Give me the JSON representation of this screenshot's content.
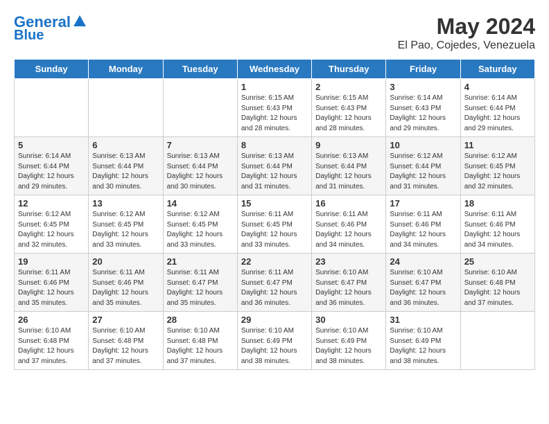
{
  "header": {
    "logo_line1": "General",
    "logo_line2": "Blue",
    "month": "May 2024",
    "location": "El Pao, Cojedes, Venezuela"
  },
  "weekdays": [
    "Sunday",
    "Monday",
    "Tuesday",
    "Wednesday",
    "Thursday",
    "Friday",
    "Saturday"
  ],
  "weeks": [
    [
      {
        "day": "",
        "info": ""
      },
      {
        "day": "",
        "info": ""
      },
      {
        "day": "",
        "info": ""
      },
      {
        "day": "1",
        "info": "Sunrise: 6:15 AM\nSunset: 6:43 PM\nDaylight: 12 hours\nand 28 minutes."
      },
      {
        "day": "2",
        "info": "Sunrise: 6:15 AM\nSunset: 6:43 PM\nDaylight: 12 hours\nand 28 minutes."
      },
      {
        "day": "3",
        "info": "Sunrise: 6:14 AM\nSunset: 6:43 PM\nDaylight: 12 hours\nand 29 minutes."
      },
      {
        "day": "4",
        "info": "Sunrise: 6:14 AM\nSunset: 6:44 PM\nDaylight: 12 hours\nand 29 minutes."
      }
    ],
    [
      {
        "day": "5",
        "info": "Sunrise: 6:14 AM\nSunset: 6:44 PM\nDaylight: 12 hours\nand 29 minutes."
      },
      {
        "day": "6",
        "info": "Sunrise: 6:13 AM\nSunset: 6:44 PM\nDaylight: 12 hours\nand 30 minutes."
      },
      {
        "day": "7",
        "info": "Sunrise: 6:13 AM\nSunset: 6:44 PM\nDaylight: 12 hours\nand 30 minutes."
      },
      {
        "day": "8",
        "info": "Sunrise: 6:13 AM\nSunset: 6:44 PM\nDaylight: 12 hours\nand 31 minutes."
      },
      {
        "day": "9",
        "info": "Sunrise: 6:13 AM\nSunset: 6:44 PM\nDaylight: 12 hours\nand 31 minutes."
      },
      {
        "day": "10",
        "info": "Sunrise: 6:12 AM\nSunset: 6:44 PM\nDaylight: 12 hours\nand 31 minutes."
      },
      {
        "day": "11",
        "info": "Sunrise: 6:12 AM\nSunset: 6:45 PM\nDaylight: 12 hours\nand 32 minutes."
      }
    ],
    [
      {
        "day": "12",
        "info": "Sunrise: 6:12 AM\nSunset: 6:45 PM\nDaylight: 12 hours\nand 32 minutes."
      },
      {
        "day": "13",
        "info": "Sunrise: 6:12 AM\nSunset: 6:45 PM\nDaylight: 12 hours\nand 33 minutes."
      },
      {
        "day": "14",
        "info": "Sunrise: 6:12 AM\nSunset: 6:45 PM\nDaylight: 12 hours\nand 33 minutes."
      },
      {
        "day": "15",
        "info": "Sunrise: 6:11 AM\nSunset: 6:45 PM\nDaylight: 12 hours\nand 33 minutes."
      },
      {
        "day": "16",
        "info": "Sunrise: 6:11 AM\nSunset: 6:46 PM\nDaylight: 12 hours\nand 34 minutes."
      },
      {
        "day": "17",
        "info": "Sunrise: 6:11 AM\nSunset: 6:46 PM\nDaylight: 12 hours\nand 34 minutes."
      },
      {
        "day": "18",
        "info": "Sunrise: 6:11 AM\nSunset: 6:46 PM\nDaylight: 12 hours\nand 34 minutes."
      }
    ],
    [
      {
        "day": "19",
        "info": "Sunrise: 6:11 AM\nSunset: 6:46 PM\nDaylight: 12 hours\nand 35 minutes."
      },
      {
        "day": "20",
        "info": "Sunrise: 6:11 AM\nSunset: 6:46 PM\nDaylight: 12 hours\nand 35 minutes."
      },
      {
        "day": "21",
        "info": "Sunrise: 6:11 AM\nSunset: 6:47 PM\nDaylight: 12 hours\nand 35 minutes."
      },
      {
        "day": "22",
        "info": "Sunrise: 6:11 AM\nSunset: 6:47 PM\nDaylight: 12 hours\nand 36 minutes."
      },
      {
        "day": "23",
        "info": "Sunrise: 6:10 AM\nSunset: 6:47 PM\nDaylight: 12 hours\nand 36 minutes."
      },
      {
        "day": "24",
        "info": "Sunrise: 6:10 AM\nSunset: 6:47 PM\nDaylight: 12 hours\nand 36 minutes."
      },
      {
        "day": "25",
        "info": "Sunrise: 6:10 AM\nSunset: 6:48 PM\nDaylight: 12 hours\nand 37 minutes."
      }
    ],
    [
      {
        "day": "26",
        "info": "Sunrise: 6:10 AM\nSunset: 6:48 PM\nDaylight: 12 hours\nand 37 minutes."
      },
      {
        "day": "27",
        "info": "Sunrise: 6:10 AM\nSunset: 6:48 PM\nDaylight: 12 hours\nand 37 minutes."
      },
      {
        "day": "28",
        "info": "Sunrise: 6:10 AM\nSunset: 6:48 PM\nDaylight: 12 hours\nand 37 minutes."
      },
      {
        "day": "29",
        "info": "Sunrise: 6:10 AM\nSunset: 6:49 PM\nDaylight: 12 hours\nand 38 minutes."
      },
      {
        "day": "30",
        "info": "Sunrise: 6:10 AM\nSunset: 6:49 PM\nDaylight: 12 hours\nand 38 minutes."
      },
      {
        "day": "31",
        "info": "Sunrise: 6:10 AM\nSunset: 6:49 PM\nDaylight: 12 hours\nand 38 minutes."
      },
      {
        "day": "",
        "info": ""
      }
    ]
  ]
}
